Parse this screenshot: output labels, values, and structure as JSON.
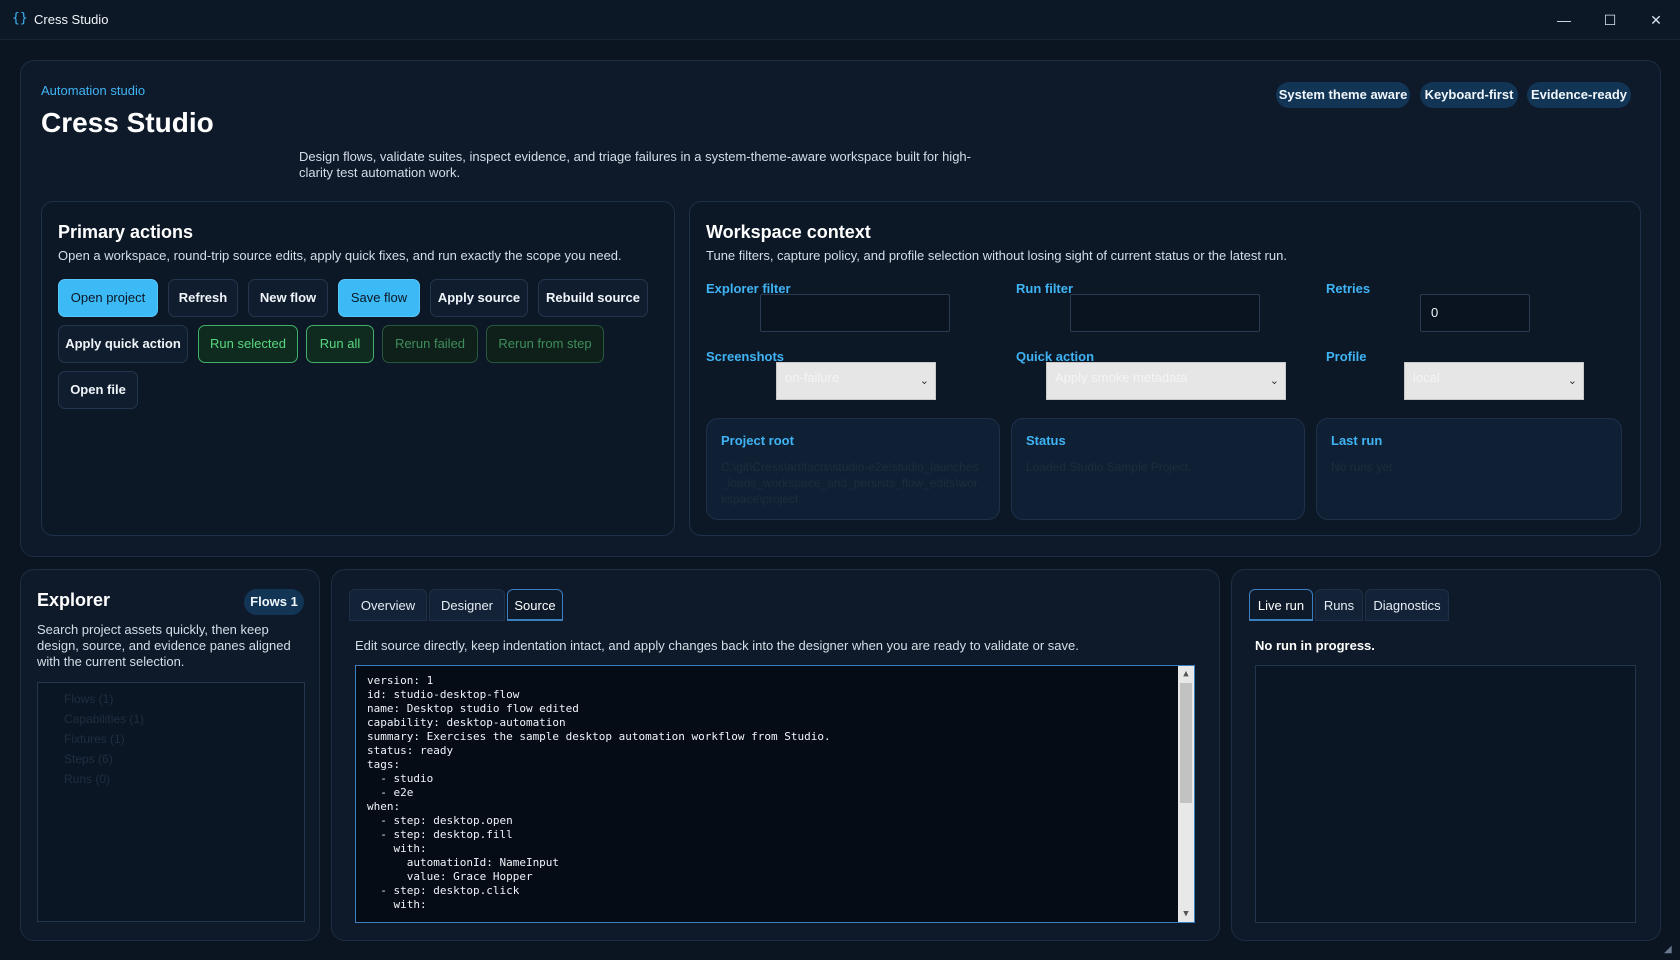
{
  "window": {
    "title": "Cress Studio",
    "icon": "braces-icon",
    "minimize": "—",
    "maximize": "☐",
    "close": "✕"
  },
  "hero": {
    "eyebrow": "Automation studio",
    "title": "Cress Studio",
    "description": "Design flows, validate suites, inspect evidence, and triage failures in a system-theme-aware workspace built for high-clarity test automation work.",
    "pills": [
      "System theme aware",
      "Keyboard-first",
      "Evidence-ready"
    ]
  },
  "primary_actions": {
    "title": "Primary actions",
    "subtitle": "Open a workspace, round-trip source edits, apply quick fixes, and run exactly the scope you need.",
    "buttons": {
      "open_project": "Open project",
      "refresh": "Refresh",
      "new_flow": "New flow",
      "save_flow": "Save flow",
      "apply_source": "Apply source",
      "rebuild_source": "Rebuild source",
      "apply_quick_action": "Apply quick action",
      "run_selected": "Run selected",
      "run_all": "Run all",
      "rerun_failed": "Rerun failed",
      "rerun_from_step": "Rerun from step",
      "open_file": "Open file"
    }
  },
  "workspace": {
    "title": "Workspace context",
    "subtitle": "Tune filters, capture policy, and profile selection without losing sight of current status or the latest run.",
    "explorer_filter": {
      "label": "Explorer filter",
      "value": ""
    },
    "run_filter": {
      "label": "Run filter",
      "value": ""
    },
    "retries": {
      "label": "Retries",
      "value": "0"
    },
    "screenshots": {
      "label": "Screenshots",
      "value": "on-failure"
    },
    "quick_action": {
      "label": "Quick action",
      "value": "Apply smoke metadata"
    },
    "profile": {
      "label": "Profile",
      "value": "local"
    },
    "project_root": {
      "label": "Project root",
      "value": "C:\\git\\Cress\\artifacts\\studio-e2e\\studio_launches_loads_workspace_and_persists_flow_edits\\workspace\\project"
    },
    "status": {
      "label": "Status",
      "value": "Loaded Studio Sample Project."
    },
    "last_run": {
      "label": "Last run",
      "value": "No runs yet"
    }
  },
  "explorer": {
    "title": "Explorer",
    "badge": "Flows 1",
    "subtitle": "Search project assets quickly, then keep design, source, and evidence panes aligned with the current selection.",
    "items": [
      "Flows (1)",
      "Capabilities (1)",
      "Fixtures (1)",
      "Steps (6)",
      "Runs (0)"
    ]
  },
  "center": {
    "tabs": [
      "Overview",
      "Designer",
      "Source"
    ],
    "hint": "Edit source directly, keep indentation intact, and apply changes back into the designer when you are ready to validate or save.",
    "code": [
      "version: 1",
      "id: studio-desktop-flow",
      "name: Desktop studio flow edited",
      "capability: desktop-automation",
      "summary: Exercises the sample desktop automation workflow from Studio.",
      "status: ready",
      "tags:",
      "  - studio",
      "  - e2e",
      "when:",
      "  - step: desktop.open",
      "  - step: desktop.fill",
      "    with:",
      "      automationId: NameInput",
      "      value: Grace Hopper",
      "  - step: desktop.click",
      "    with:"
    ]
  },
  "right": {
    "tabs": [
      "Live run",
      "Runs",
      "Diagnostics"
    ],
    "status": "No run in progress."
  }
}
